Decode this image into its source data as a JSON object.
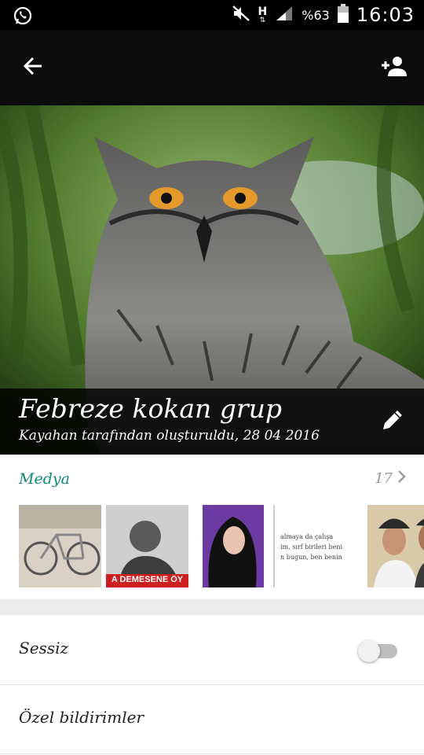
{
  "status_bar": {
    "signal_type": "H",
    "battery": "%63",
    "time": "16:03",
    "icons": [
      "whatsapp-icon",
      "mute-icon",
      "network-h-icon",
      "signal-icon",
      "battery-icon"
    ]
  },
  "toolbar": {
    "back_icon": "arrow-left-icon",
    "add_participant_icon": "add-person-icon"
  },
  "group": {
    "name": "Febreze kokan grup",
    "created_by": "Kayahan tarafından oluşturuldu, 28 04 2016",
    "edit_icon": "pencil-icon"
  },
  "media": {
    "title": "Medya",
    "count": "17",
    "thumbnails": [
      {
        "id": "bicycle-photo"
      },
      {
        "id": "banner-photo",
        "caption": "A DEMESENE ÖY"
      },
      {
        "id": "portrait-photo"
      },
      {
        "id": "text-screenshot",
        "lines": [
          "almaya da çalışa",
          "im, sırf birileri beni",
          "n bugun, ben benin"
        ]
      },
      {
        "id": "selfie-photo"
      }
    ]
  },
  "settings": {
    "mute_label": "Sessiz",
    "mute_enabled": false,
    "custom_notifications_label": "Özel bildirimler"
  },
  "colors": {
    "accent": "#0d8a7a",
    "statusbar": "#000000",
    "toolbar": "#0c0c0c"
  }
}
